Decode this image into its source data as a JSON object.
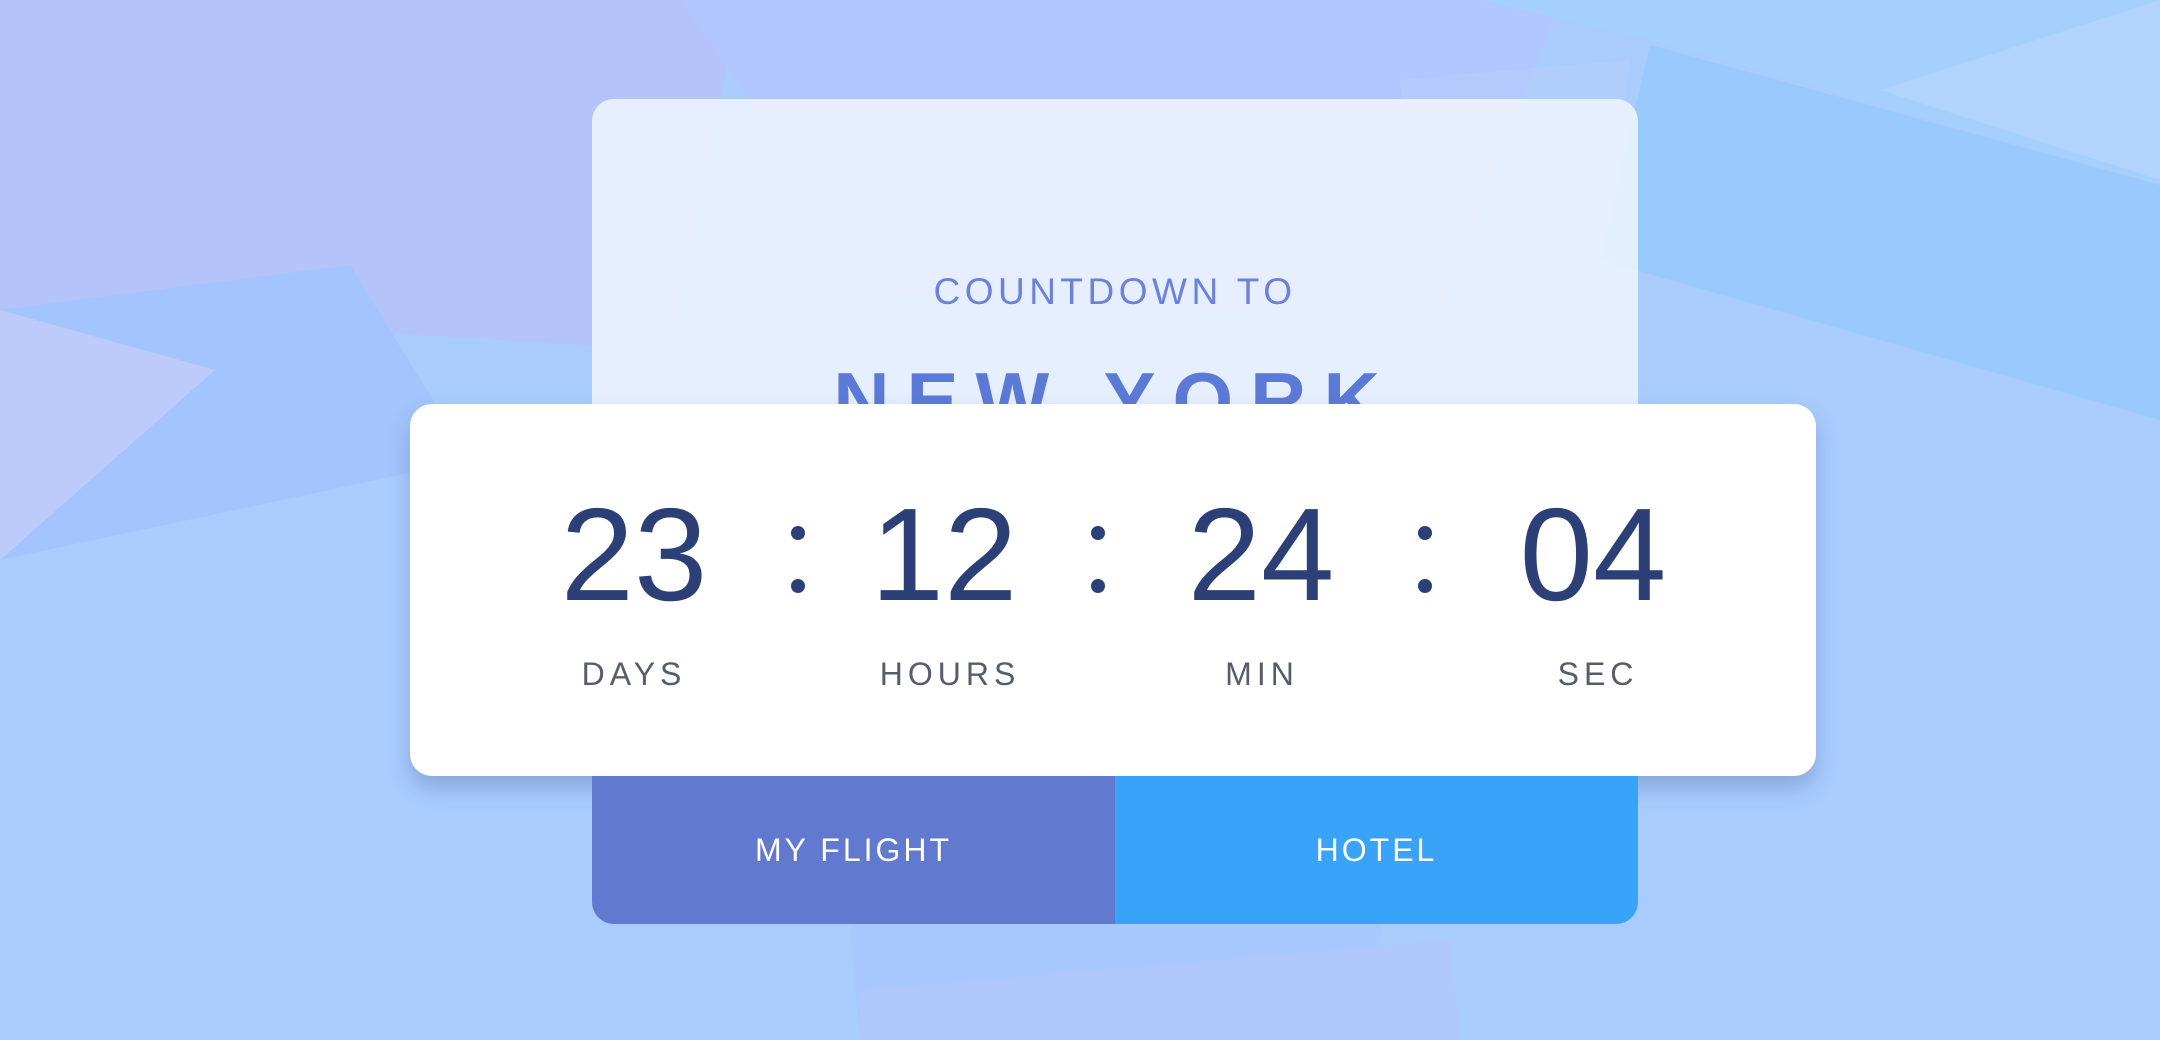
{
  "colors": {
    "background": "#a9ccfd",
    "accent_title": "#5b79d6",
    "digits": "#2c3f77",
    "flight_button": "#6179cf",
    "hotel_button": "#38a3f8"
  },
  "header": {
    "subtitle": "COUNTDOWN TO",
    "destination": "NEW YORK"
  },
  "countdown": {
    "days": {
      "value": "23",
      "label": "DAYS"
    },
    "hours": {
      "value": "12",
      "label": "HOURS"
    },
    "minutes": {
      "value": "24",
      "label": "MIN"
    },
    "seconds": {
      "value": "04",
      "label": "SEC"
    }
  },
  "actions": {
    "flight_label": "MY FLIGHT",
    "hotel_label": "HOTEL"
  }
}
